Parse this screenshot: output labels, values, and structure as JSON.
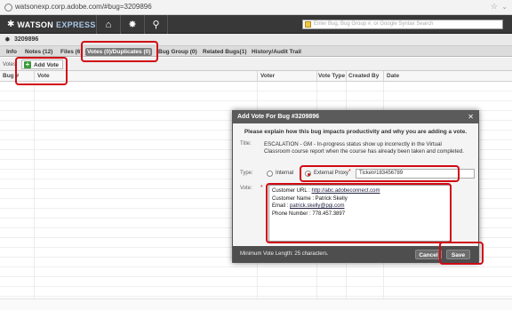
{
  "browser": {
    "url": "watsonexp.corp.adobe.com/#bug=3209896"
  },
  "header": {
    "logo_primary": "WATSON",
    "logo_secondary": "EXPRESS",
    "buttons": [
      "home-icon",
      "bug-icon",
      "search-icon"
    ],
    "search_placeholder": "Enter Bug, Bug Group #, or Google Syntax Search"
  },
  "bug": {
    "id": "3209896"
  },
  "tabs": [
    {
      "label": "Info",
      "active": false
    },
    {
      "label": "Notes (12)",
      "active": false
    },
    {
      "label": "Files (6)",
      "active": false
    },
    {
      "label": "Votes (0)/Duplicates (0)",
      "active": true
    },
    {
      "label": "Bug Group (0)",
      "active": false
    },
    {
      "label": "Related Bugs(1)",
      "active": false
    },
    {
      "label": "History/Audit Trail",
      "active": false
    }
  ],
  "votes_toolbar": {
    "label": "Votes",
    "add_vote": "Add Vote"
  },
  "columns": [
    "Bug #",
    "Vote",
    "Voter",
    "Vote Type",
    "Created By",
    "Date"
  ],
  "dialog": {
    "title": "Add Vote For Bug #3209896",
    "instructions": "Please explain how this bug impacts productivity and why you are adding a vote.",
    "title_label": "Title:",
    "title_value": "ESCALATION - GM - In-progress status show up incorrectly in the Virtual Classroom course report when the course has already been taken and completed.",
    "type_label": "Type:",
    "type_options": [
      "Internal",
      "External Proxy"
    ],
    "type_selected": "External Proxy",
    "proxy_value": "Ticket#183456789",
    "vote_label": "Vote:",
    "vote_lines": [
      {
        "prefix": "Customer URL : ",
        "link": "http://abc.adobeconnect.com"
      },
      {
        "prefix": "Customer Name : Patrick Skelly",
        "link": ""
      },
      {
        "prefix": "Email : ",
        "link": "patrick.skelly@pgi.com"
      },
      {
        "prefix": "Phone Number : 778.457.3897",
        "link": ""
      }
    ],
    "min_length": "Minimum Vote Length: 25 characters.",
    "cancel": "Cancel",
    "save": "Save"
  },
  "colors": {
    "header_bg": "#383838",
    "accent_red": "#d10b14",
    "active_tab": "#7a7a7a"
  }
}
